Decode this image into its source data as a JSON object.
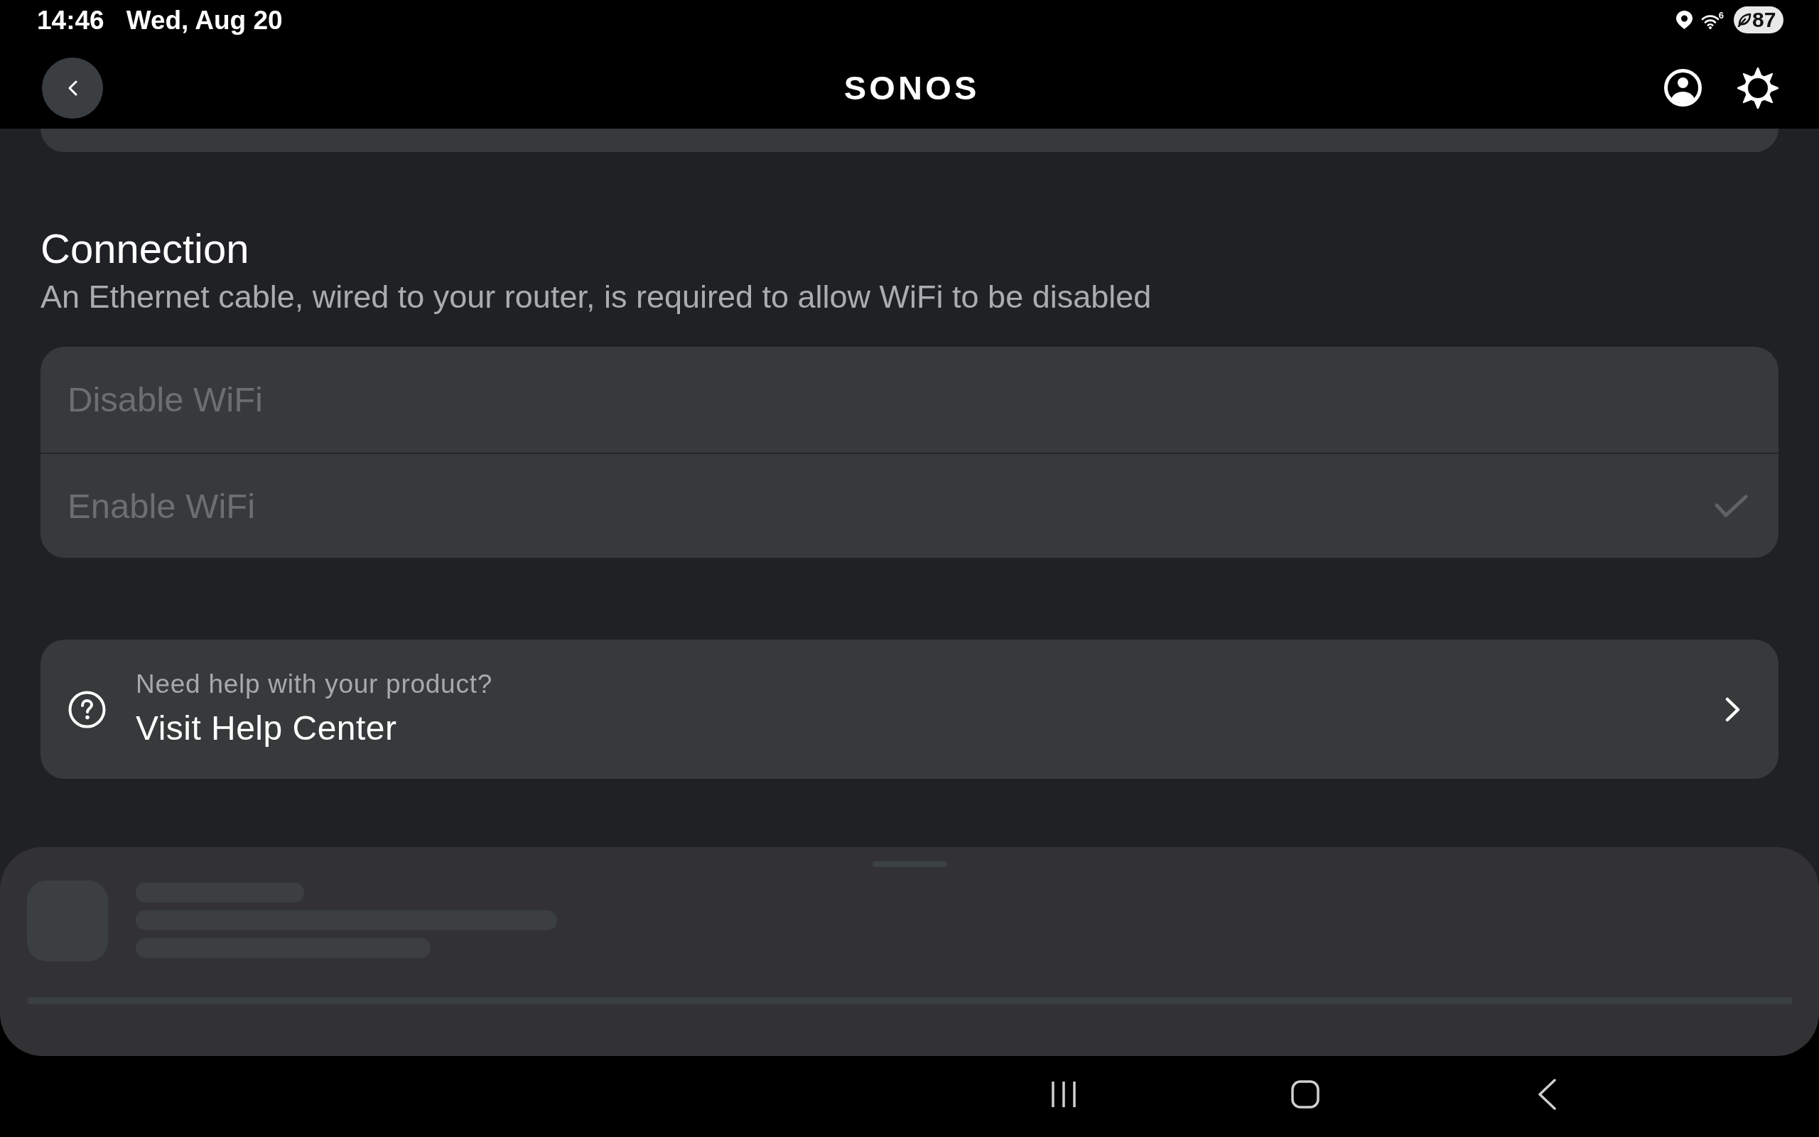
{
  "status_bar": {
    "time": "14:46",
    "date": "Wed, Aug 20",
    "wifi_badge": "6",
    "battery": "87"
  },
  "header": {
    "logo": "SONOS"
  },
  "connection": {
    "title": "Connection",
    "description": "An Ethernet cable, wired to your router, is required to allow WiFi to be disabled",
    "options": [
      {
        "label": "Disable WiFi",
        "selected": false,
        "disabled": true
      },
      {
        "label": "Enable WiFi",
        "selected": true,
        "disabled": true
      }
    ]
  },
  "help": {
    "caption": "Need help with your product?",
    "title": "Visit Help Center"
  }
}
